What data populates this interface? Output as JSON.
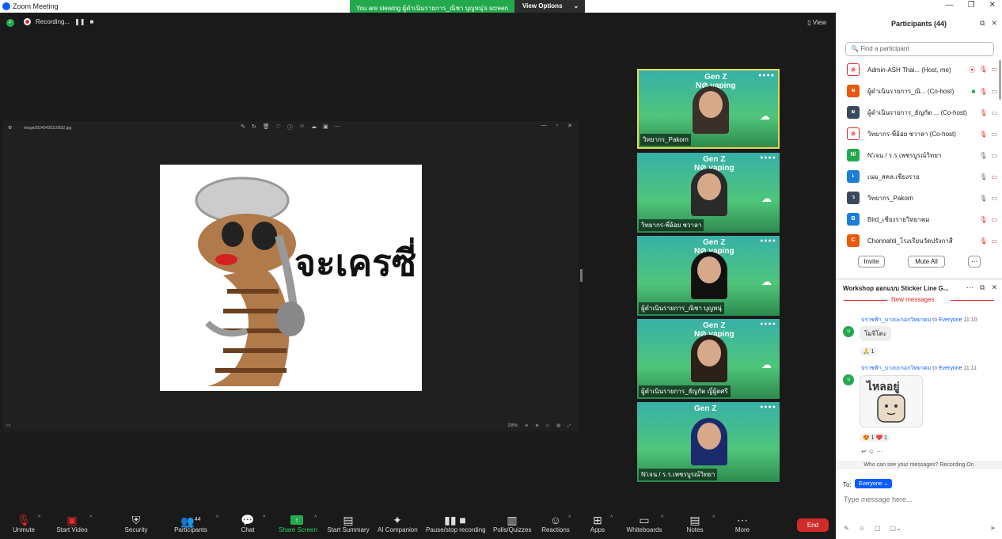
{
  "window": {
    "title": "Zoom Meeting",
    "min": "—",
    "max": "❐",
    "close": "✕"
  },
  "banner": {
    "viewing_text": "You are viewing ผู้ดำเนินรายการ_ณิชา บุญหนุ่'s screen",
    "view_options": "View Options",
    "caret": "⌄"
  },
  "topbar": {
    "recording": "Recording...",
    "pause": "❚❚",
    "stop": "■",
    "view": "View"
  },
  "shared": {
    "file_name": "image20240430110832.jpg",
    "tools": [
      "✎",
      "↻",
      "🗑",
      "♡",
      "ⓘ",
      "☺",
      "☁",
      "▣",
      "⋯"
    ],
    "window_controls": [
      "—",
      "▫",
      "✕"
    ],
    "zoom": "235%",
    "zoom_tools": [
      "⊖",
      "⊕",
      "▭",
      "▤",
      "⤢"
    ],
    "sticker_text": "จะเครซี่"
  },
  "tiles": [
    {
      "brand": "Gen Z",
      "brand2": "N⊘ vaping",
      "name": "วิทยากร_Pakorn"
    },
    {
      "brand": "Gen Z",
      "brand2": "N⊘ vaping",
      "name": "วิทยากร-พี่อ้อย ชวาลา"
    },
    {
      "brand": "Gen Z",
      "brand2": "N⊘ vaping",
      "name": "ผู้ดำเนินรายการ_ณิชา บุญหนุ่"
    },
    {
      "brand": "Gen Z",
      "brand2": "N⊘ vaping",
      "name": "ผู้ดำเนินรายการ_ธัญกัต ญี่ผู้ดศรี"
    },
    {
      "brand": "Gen Z",
      "brand2": "",
      "name": "N'เจน / ร.ร.เพชรบูรณ์วิทยา"
    }
  ],
  "participants": {
    "title": "Participants (44)",
    "search_placeholder": "Find a participant",
    "rows": [
      {
        "initial": "⊘",
        "name": "Admin-ASH Thai... (Host, me)",
        "color": "#e02828"
      },
      {
        "initial": "ผ",
        "name": "ผู้ดำเนินรายการ_ณิ... (Co-host)",
        "color": "#e8590c"
      },
      {
        "initial": "ผ",
        "name": "ผู้ดำเนินรายการ_ธัญกัต ... (Co-host)",
        "color": "#3a4a5c"
      },
      {
        "initial": "⊘",
        "name": "วิทยากร-พี่อ้อย ชวาลา (Co-host)",
        "color": "#e02828"
      },
      {
        "initial": "N/",
        "name": "N'เจน / ร.ร.เพชรบูรณ์วิทยา",
        "color": "#23a94d"
      },
      {
        "initial": "เ",
        "name": "เนม_สคล.เชียงราย",
        "color": "#1c7ed6"
      },
      {
        "initial": "ว",
        "name": "วิทยากร_Pakorn",
        "color": "#3a4a5c"
      },
      {
        "initial": "B",
        "name": "Bird_เชียงรายวิทยาคม",
        "color": "#1c7ed6"
      },
      {
        "initial": "C",
        "name": "Chonnahti_โรงเรียนวัดปรังกาสี",
        "color": "#e8590c"
      }
    ],
    "invite": "Invite",
    "mute_all": "Mute All",
    "more": "⋯"
  },
  "chat": {
    "title": "Workshop ออกแบบ Sticker Line G...",
    "new_messages": "New messages",
    "messages": [
      {
        "sender": "ปราชฟ้า_บางปะกอกวิทยาคม",
        "to": "to",
        "audience": "Everyone",
        "time": "11:10",
        "text": "โมจิโตะ",
        "reaction": "🙏 1"
      },
      {
        "sender": "ปราชฟ้า_บางปะกอกวิทยาคม",
        "to": "to",
        "audience": "Everyone",
        "time": "11:11",
        "text": "ไหลอยู่",
        "reaction": "😍 1  ❤️ 1"
      }
    ],
    "avatar": "ป",
    "who_can_see": "Who can see your messages? Recording On",
    "to_label": "To:",
    "recipient": "Everyone ⌄",
    "input_placeholder": "Type message here...",
    "actions": "↩  ☺  ⋯",
    "tools": [
      "✎",
      "☺",
      "▢",
      "▢⌄"
    ],
    "send": "➤"
  },
  "toolbar": {
    "unmute": "Unmute",
    "start_video": "Start Video",
    "security": "Security",
    "participants": "Participants",
    "participants_count": "44",
    "chat": "Chat",
    "share_screen": "Share Screen",
    "start_summary": "Start Summary",
    "ai_companion": "AI Companion",
    "pause_recording": "Pause/stop recording",
    "polls": "Polls/Quizzes",
    "reactions": "Reactions",
    "apps": "Apps",
    "whiteboards": "Whiteboards",
    "notes": "Notes",
    "more": "More",
    "end": "End"
  },
  "colors": {
    "accent": "#0b5cff",
    "share_green": "#23a94d",
    "end_red": "#d12a2a",
    "mute_red": "#e02828"
  }
}
